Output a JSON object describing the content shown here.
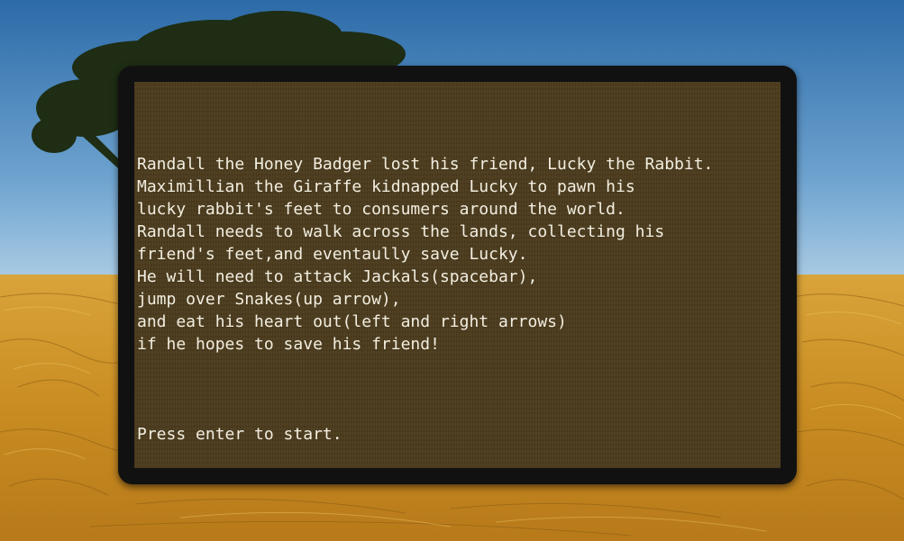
{
  "story": {
    "lines": [
      "Randall the Honey Badger lost his friend, Lucky the Rabbit.",
      "Maximillian the Giraffe kidnapped Lucky to pawn his",
      "lucky rabbit's feet to consumers around the world.",
      "Randall needs to walk across the lands, collecting his",
      "friend's feet,and eventaully save Lucky.",
      "He will need to attack Jackals(spacebar),",
      "jump over Snakes(up arrow),",
      "and eat his heart out(left and right arrows)",
      "if he hopes to save his friend!"
    ],
    "prompt": "Press enter to start."
  },
  "colors": {
    "sky_top": "#2f6fae",
    "sky_bottom": "#a9cbe4",
    "grass": "#d49a2a",
    "tree": "#1e2d14",
    "panel_frame": "#111111",
    "parchment": "#4a3a1c",
    "text": "#f2eee0"
  }
}
